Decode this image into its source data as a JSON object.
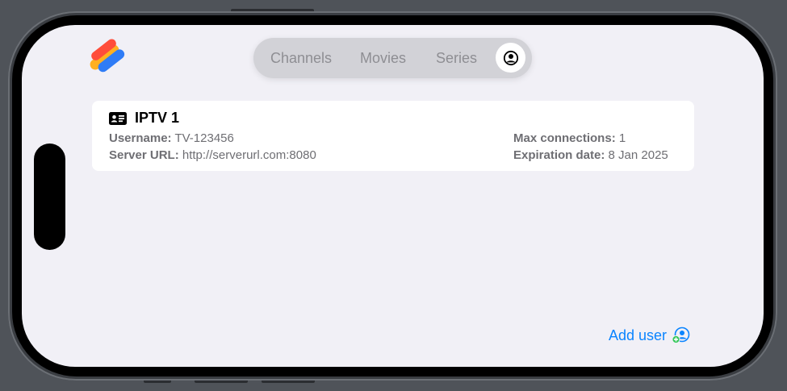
{
  "header": {
    "tabs": [
      {
        "label": "Channels"
      },
      {
        "label": "Movies"
      },
      {
        "label": "Series"
      }
    ],
    "active_tab_icon": "person-circle-icon"
  },
  "account": {
    "title": "IPTV 1",
    "username_label": "Username:",
    "username_value": "TV-123456",
    "server_label": "Server URL:",
    "server_value": "http://serverurl.com:8080",
    "max_label": "Max connections:",
    "max_value": "1",
    "exp_label": "Expiration date:",
    "exp_value": "8 Jan 2025"
  },
  "footer": {
    "add_user_label": "Add user",
    "add_user_icon": "person-add-icon"
  },
  "colors": {
    "accent": "#0a84ff",
    "background": "#f1f0f6"
  }
}
